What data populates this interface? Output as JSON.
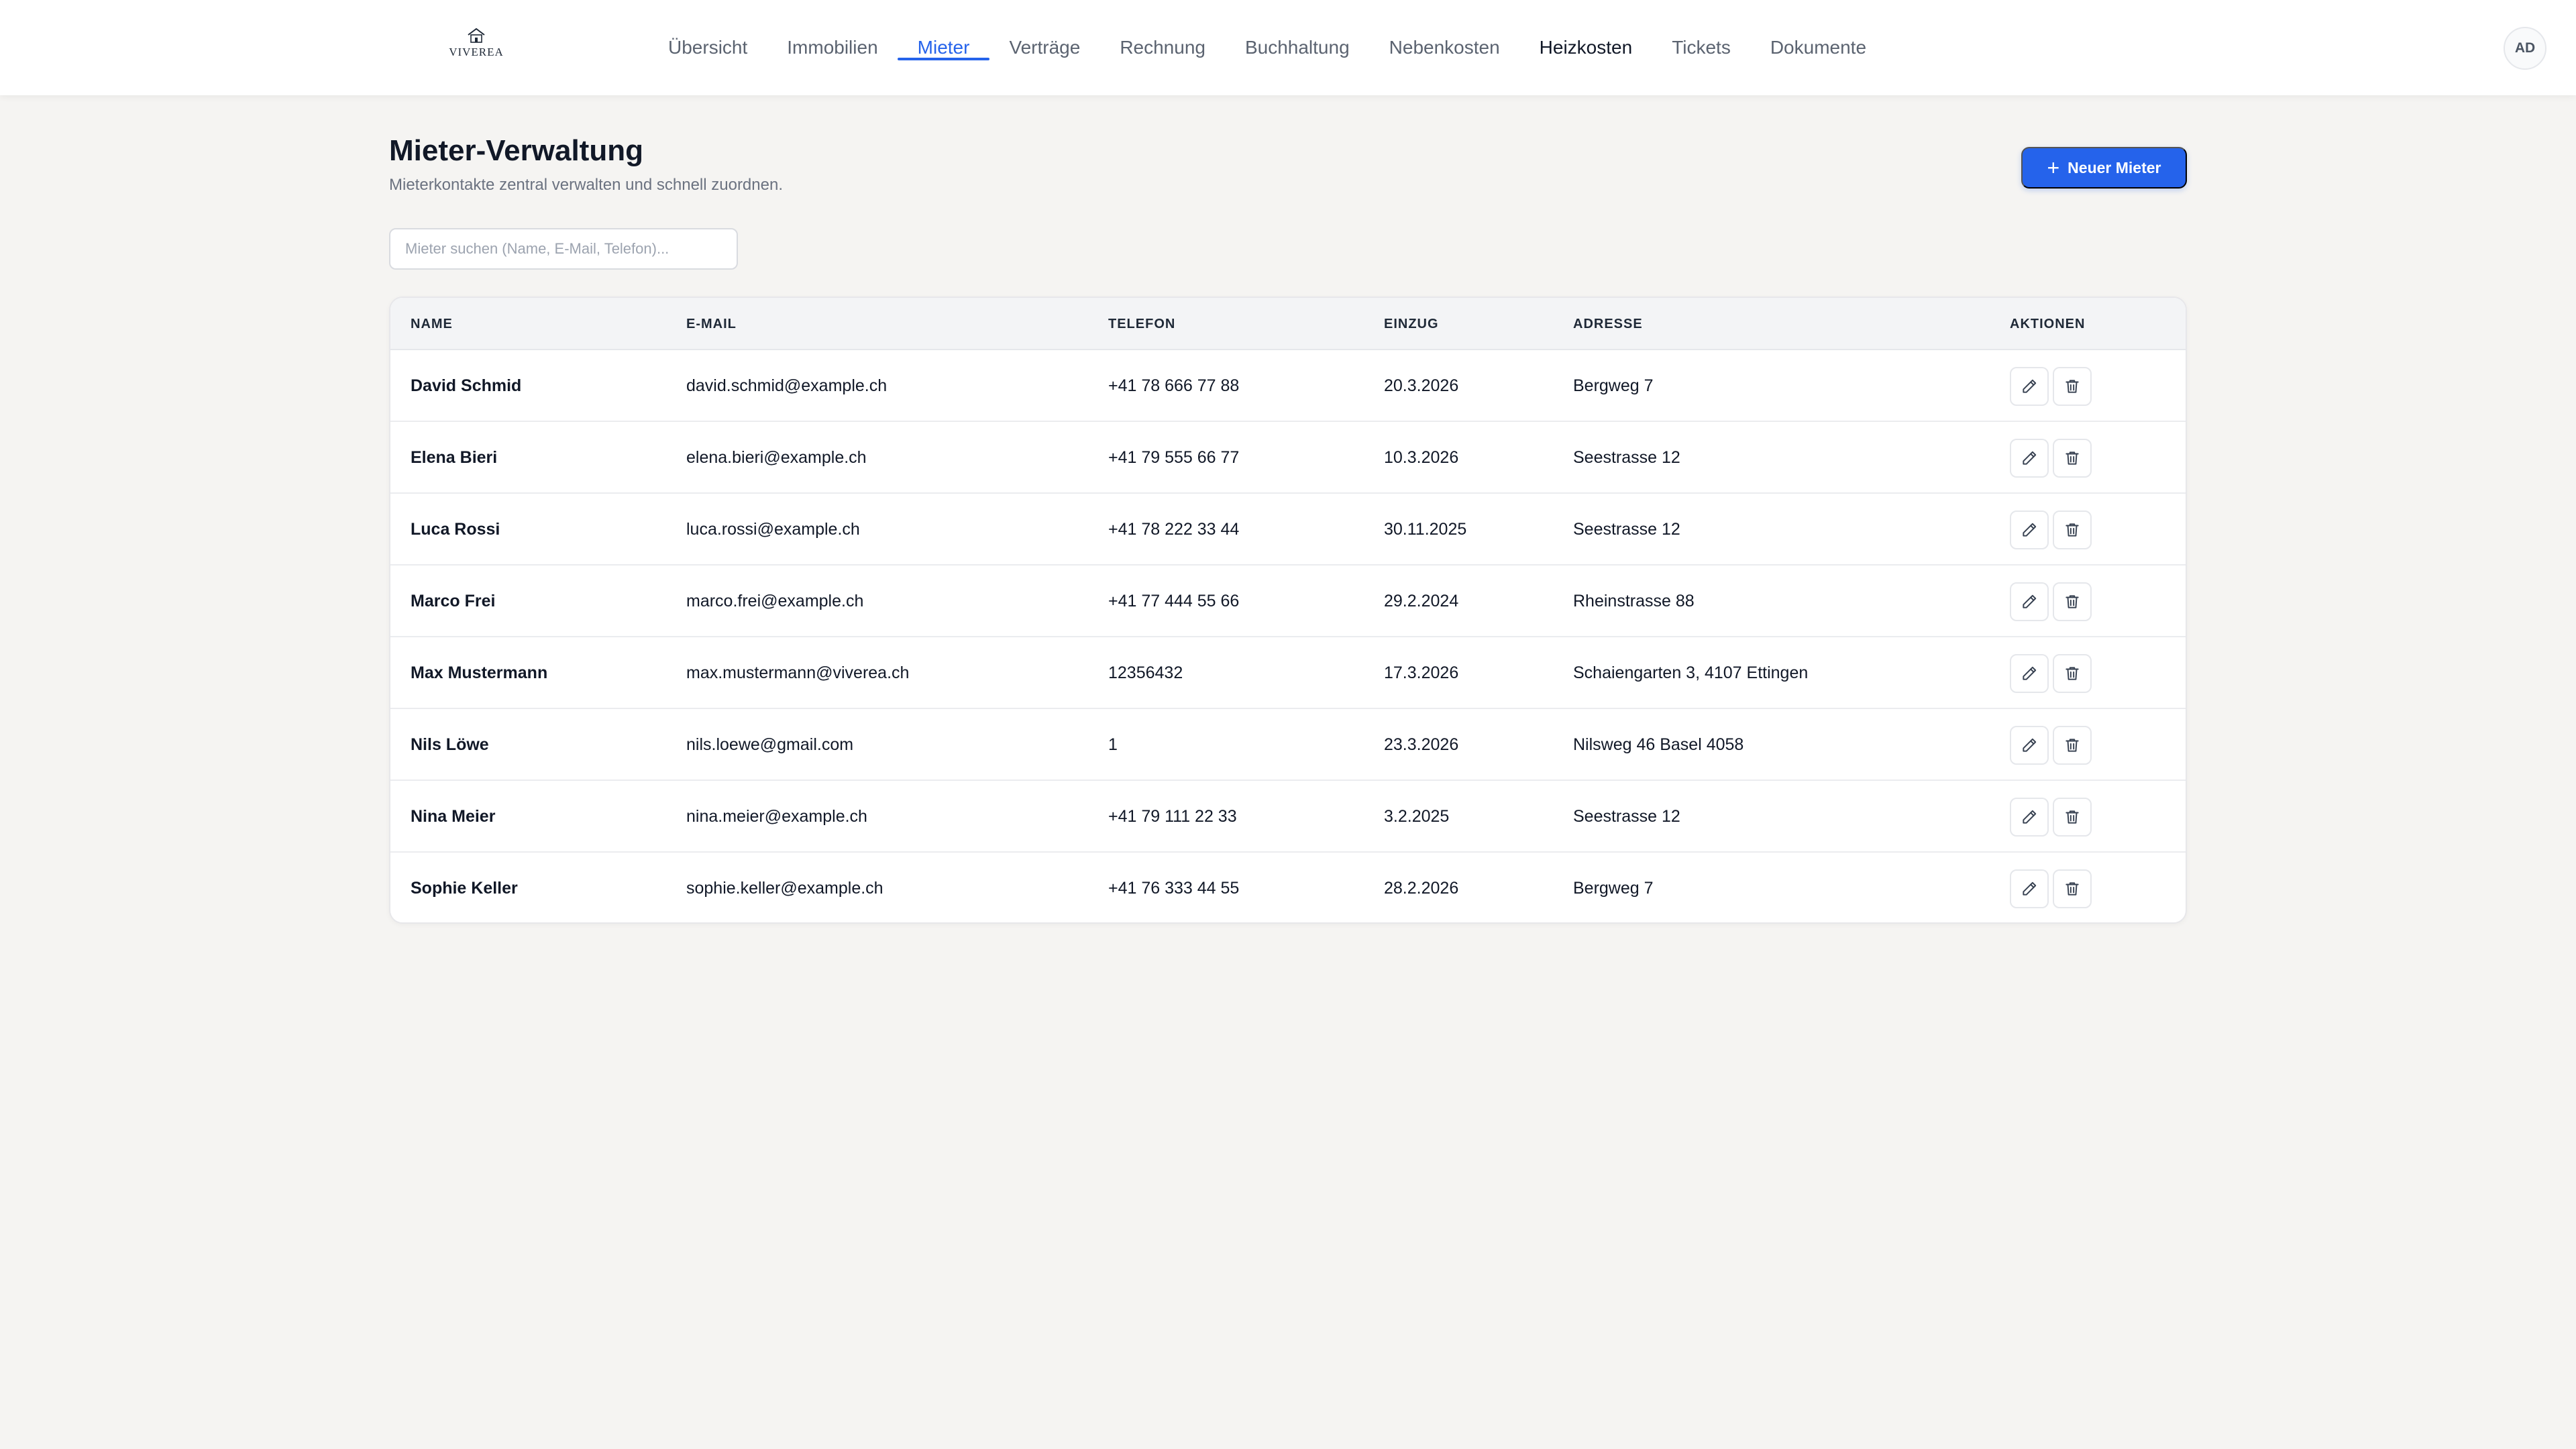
{
  "header": {
    "logo_text": "VIVEREA",
    "nav": [
      {
        "label": "Übersicht",
        "state": "default"
      },
      {
        "label": "Immobilien",
        "state": "default"
      },
      {
        "label": "Mieter",
        "state": "active"
      },
      {
        "label": "Verträge",
        "state": "default"
      },
      {
        "label": "Rechnung",
        "state": "default"
      },
      {
        "label": "Buchhaltung",
        "state": "default"
      },
      {
        "label": "Nebenkosten",
        "state": "default"
      },
      {
        "label": "Heizkosten",
        "state": "dark"
      },
      {
        "label": "Tickets",
        "state": "default"
      },
      {
        "label": "Dokumente",
        "state": "default"
      }
    ],
    "avatar_initials": "AD"
  },
  "page": {
    "title": "Mieter-Verwaltung",
    "subtitle": "Mieterkontakte zentral verwalten und schnell zuordnen.",
    "new_button_label": "Neuer Mieter",
    "search_placeholder": "Mieter suchen (Name, E-Mail, Telefon)..."
  },
  "table": {
    "columns": {
      "name": "NAME",
      "email": "E-MAIL",
      "phone": "TELEFON",
      "move_in": "EINZUG",
      "address": "ADRESSE",
      "actions": "AKTIONEN"
    },
    "rows": [
      {
        "name": "David Schmid",
        "email": "david.schmid@example.ch",
        "phone": "+41 78 666 77 88",
        "move_in": "20.3.2026",
        "address": "Bergweg 7"
      },
      {
        "name": "Elena Bieri",
        "email": "elena.bieri@example.ch",
        "phone": "+41 79 555 66 77",
        "move_in": "10.3.2026",
        "address": "Seestrasse 12"
      },
      {
        "name": "Luca Rossi",
        "email": "luca.rossi@example.ch",
        "phone": "+41 78 222 33 44",
        "move_in": "30.11.2025",
        "address": "Seestrasse 12"
      },
      {
        "name": "Marco Frei",
        "email": "marco.frei@example.ch",
        "phone": "+41 77 444 55 66",
        "move_in": "29.2.2024",
        "address": "Rheinstrasse 88"
      },
      {
        "name": "Max Mustermann",
        "email": "max.mustermann@viverea.ch",
        "phone": "12356432",
        "move_in": "17.3.2026",
        "address": "Schaiengarten 3, 4107 Ettingen"
      },
      {
        "name": "Nils Löwe",
        "email": "nils.loewe@gmail.com",
        "phone": "1",
        "move_in": "23.3.2026",
        "address": "Nilsweg 46 Basel 4058"
      },
      {
        "name": "Nina Meier",
        "email": "nina.meier@example.ch",
        "phone": "+41 79 111 22 33",
        "move_in": "3.2.2025",
        "address": "Seestrasse 12"
      },
      {
        "name": "Sophie Keller",
        "email": "sophie.keller@example.ch",
        "phone": "+41 76 333 44 55",
        "move_in": "28.2.2026",
        "address": "Bergweg 7"
      }
    ],
    "row_actions": [
      "pencil-icon",
      "trash-icon"
    ]
  },
  "colors": {
    "accent": "#2563eb",
    "background": "#f5f4f2",
    "card": "#ffffff",
    "table_header": "#f3f4f6"
  }
}
